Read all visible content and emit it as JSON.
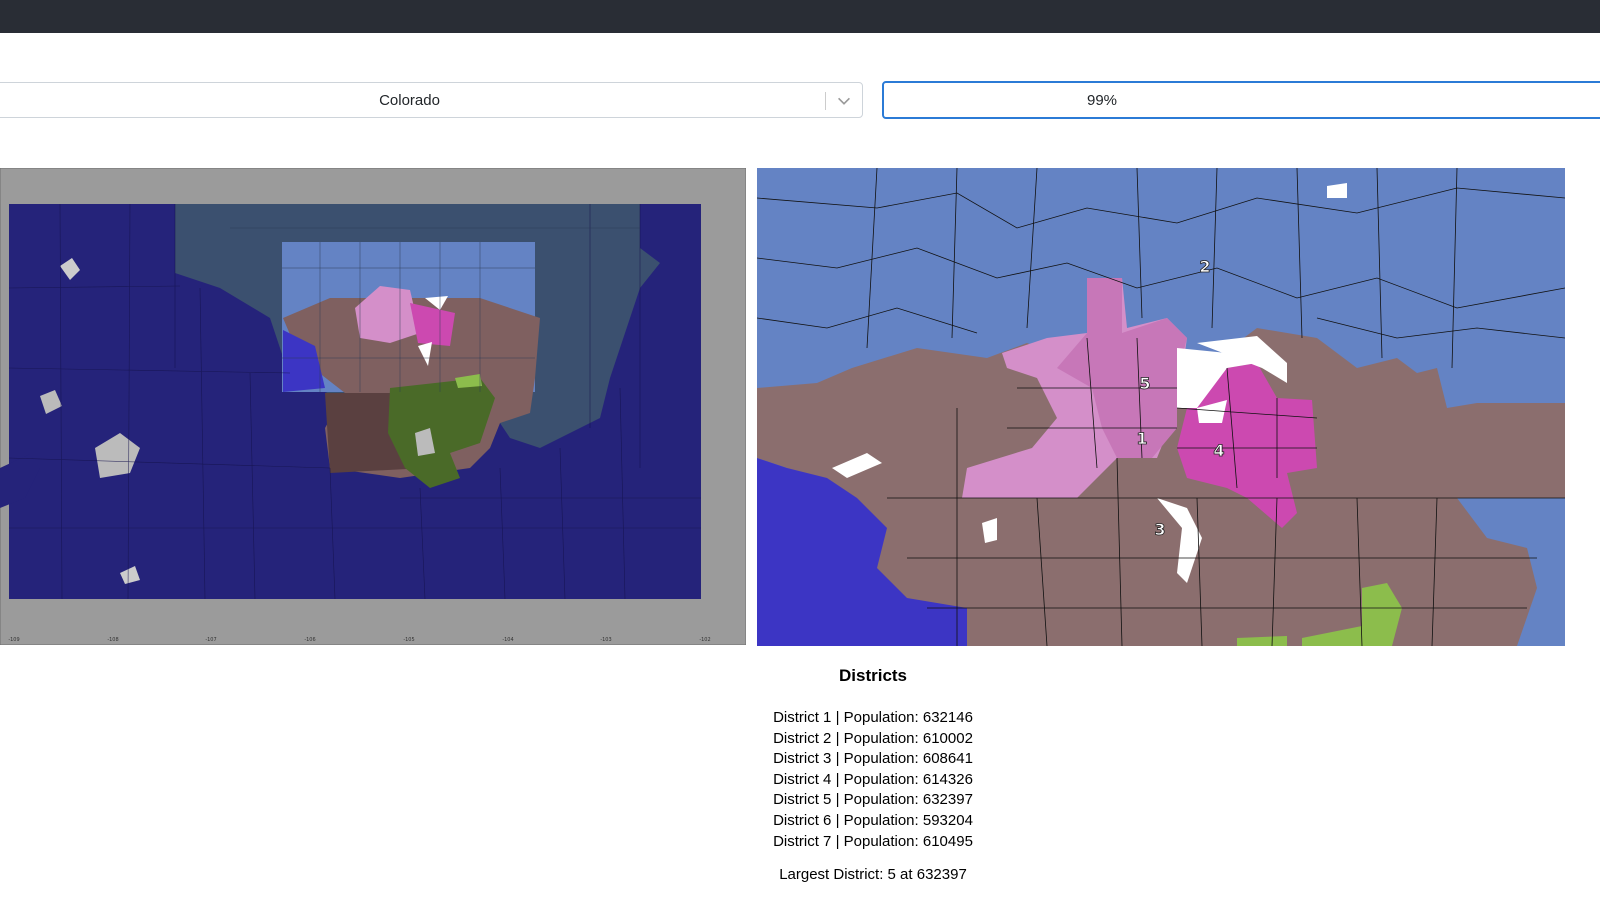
{
  "state_select": {
    "value": "Colorado"
  },
  "threshold_input": {
    "value": "99%"
  },
  "map_left": {
    "tick_labels": [
      "-109",
      "-108",
      "-107",
      "-106",
      "-105",
      "-104",
      "-103",
      "-102"
    ]
  },
  "map_right": {
    "district_labels": [
      "1",
      "2",
      "3",
      "4",
      "5"
    ]
  },
  "districts": {
    "title": "Districts",
    "items": [
      "District 1 | Population: 632146",
      "District 2 | Population: 610002",
      "District 3 | Population: 608641",
      "District 4 | Population: 614326",
      "District 5 | Population: 632397",
      "District 6 | Population: 593204",
      "District 7 | Population: 610495"
    ],
    "largest": "Largest District: 5 at 632397"
  },
  "colors": {
    "topbar": "#292d35",
    "focus_border": "#2b7bd6",
    "district_navy": "#25237a",
    "district_blue": "#6483c4",
    "district_brown": "#8b6e6e",
    "district_pink": "#d48fc9",
    "district_magenta": "#cc49b0",
    "district_green": "#8cbd4c",
    "district_violet": "#3c35c4"
  }
}
